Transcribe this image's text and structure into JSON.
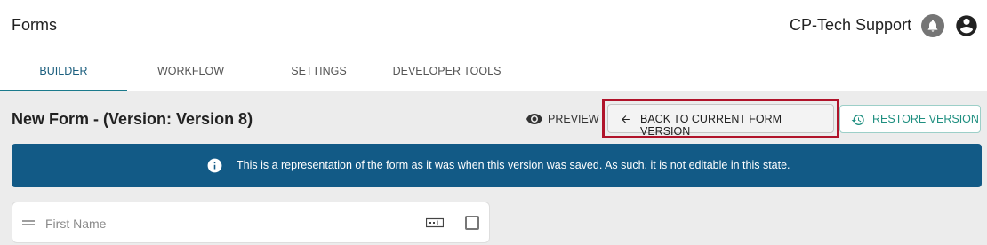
{
  "header": {
    "title": "Forms",
    "user": "CP-Tech Support",
    "icons": [
      "notification-bell-icon",
      "account-circle-icon"
    ]
  },
  "tabs": [
    {
      "label": "BUILDER",
      "active": true
    },
    {
      "label": "WORKFLOW",
      "active": false
    },
    {
      "label": "SETTINGS",
      "active": false
    },
    {
      "label": "DEVELOPER TOOLS",
      "active": false
    }
  ],
  "toolbar": {
    "form_title": "New Form - (Version: Version 8)",
    "preview_label": "PREVIEW",
    "back_label": "BACK TO CURRENT FORM VERSION",
    "restore_label": "RESTORE VERSION"
  },
  "banner": {
    "message": "This is a representation of the form as it was when this version was saved. As such, it is not editable in this state."
  },
  "fields": [
    {
      "label": "First Name",
      "type_icon": "text-field-icon",
      "checked": false
    }
  ],
  "colors": {
    "banner_bg": "#125a86",
    "active_tab": "#1b5e7e",
    "restore_accent": "#1f8f80",
    "highlight_border": "#b0132a"
  }
}
